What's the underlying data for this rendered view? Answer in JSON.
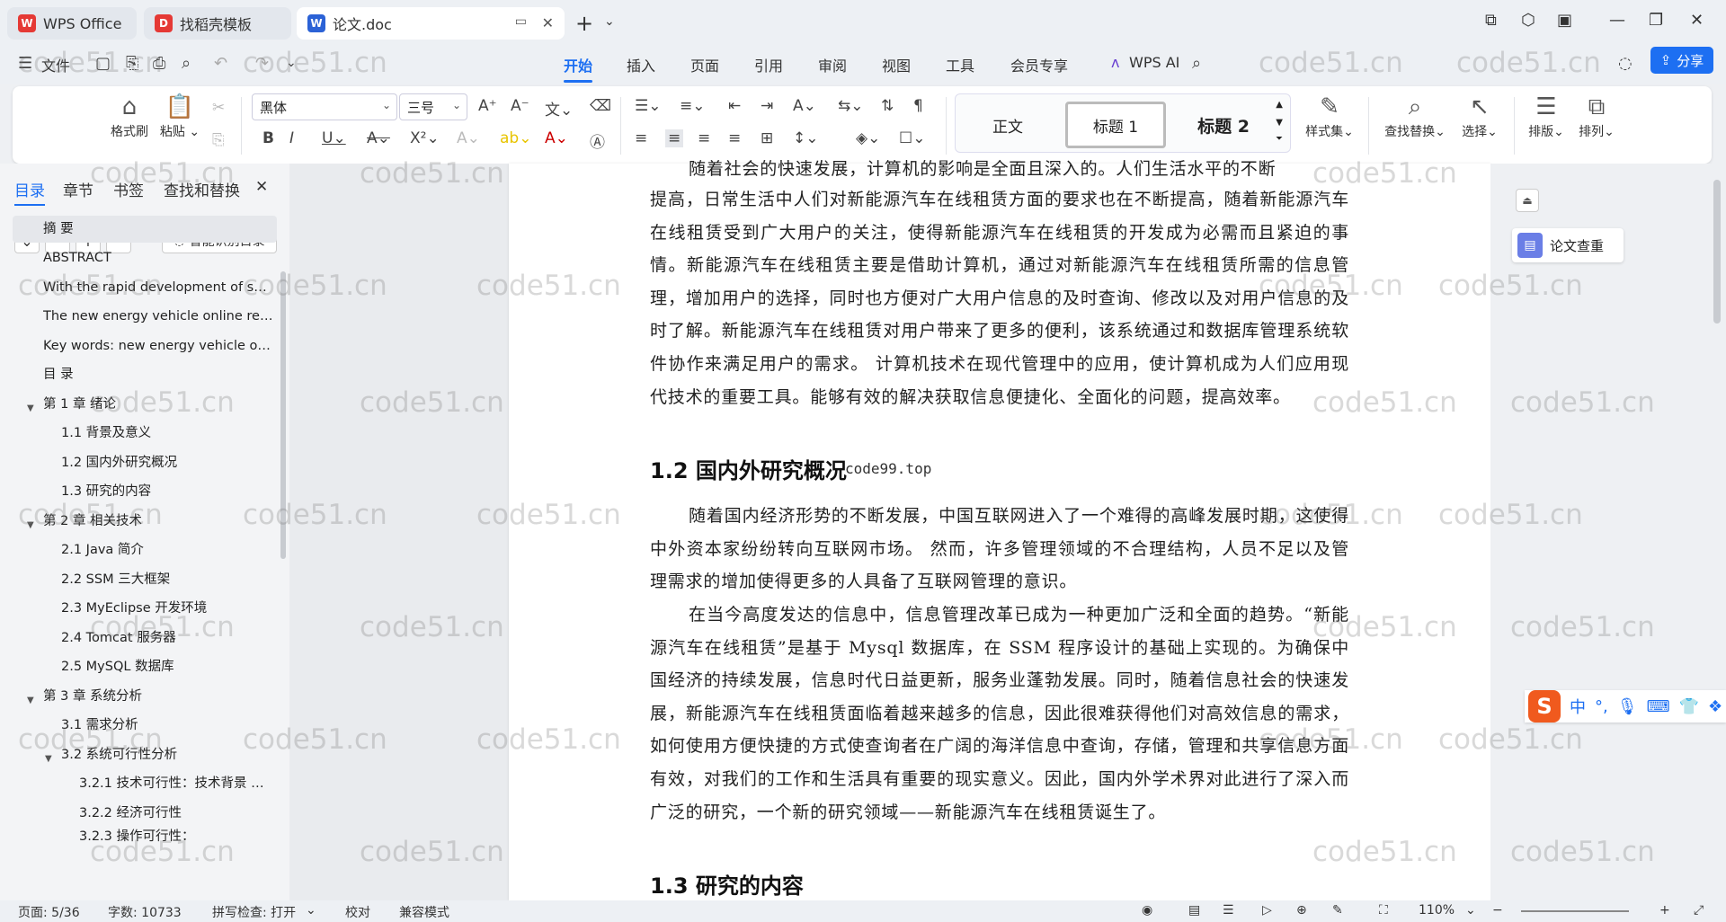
{
  "tabs": [
    {
      "label": "WPS Office",
      "logo": "W"
    },
    {
      "label": "找稻壳模板",
      "logo": "D"
    },
    {
      "label": "论文.doc",
      "logo": "W"
    }
  ],
  "menu": {
    "file": "文件",
    "items": [
      "开始",
      "插入",
      "页面",
      "引用",
      "审阅",
      "视图",
      "工具",
      "会员专享"
    ],
    "active": "开始",
    "wps_ai": "WPS AI",
    "share": "分享"
  },
  "ribbon": {
    "format_painter": "格式刷",
    "paste": "粘贴",
    "font": "黑体",
    "size": "三号",
    "styles": [
      "正文",
      "标题 1",
      "标题 2"
    ],
    "style_set": "样式集",
    "find_replace": "查找替换",
    "select": "选择",
    "layout": "排版",
    "arrange": "排列"
  },
  "sidebar": {
    "tabs": [
      "目录",
      "章节",
      "书签",
      "查找和替换"
    ],
    "ai_toc": "智能识别目录",
    "toc": [
      "摘  要",
      "ABSTRACT",
      "With the rapid development of s…",
      "The new energy vehicle online re…",
      "Key words: new energy vehicle o…",
      "目  录",
      "第 1 章  绪论",
      "1.1 背景及意义",
      "1.2 国内外研究概况",
      "1.3 研究的内容",
      "第 2 章  相关技术",
      "2.1 Java 简介",
      "2.2 SSM 三大框架",
      "2.3 MyEclipse 开发环境",
      "2.4 Tomcat 服务器",
      "2.5 MySQL 数据库",
      "第 3 章  系统分析",
      "3.1 需求分析",
      "3.2 系统可行性分析",
      "3.2.1 技术可行性：技术背景  …",
      "3.2.2 经济可行性",
      "3.2.3 操作可行性："
    ]
  },
  "document": {
    "p0_top": "随着社会的快速发展，计算机的影响是全面且深入的。人们生活水平的不断",
    "p0": "提高，日常生活中人们对新能源汽车在线租赁方面的要求也在不断提高，随着新能源汽车在线租赁受到广大用户的关注，使得新能源汽车在线租赁的开发成为必需而且紧迫的事情。新能源汽车在线租赁主要是借助计算机，通过对新能源汽车在线租赁所需的信息管理，增加用户的选择，同时也方便对广大用户信息的及时查询、修改以及对用户信息的及时了解。新能源汽车在线租赁对用户带来了更多的便利，该系统通过和数据库管理系统软件协作来满足用户的需求。 计算机技术在现代管理中的应用，使计算机成为人们应用现代技术的重要工具。能够有效的解决获取信息便捷化、全面化的问题，提高效率。",
    "h12": "1.2  国内外研究概况",
    "overlay": "code99.top",
    "p1": "随着国内经济形势的不断发展，中国互联网进入了一个难得的高峰发展时期，这使得中外资本家纷纷转向互联网市场。 然而，许多管理领域的不合理结构，人员不足以及管理需求的增加使得更多的人具备了互联网管理的意识。",
    "p2": "在当今高度发达的信息中，信息管理改革已成为一种更加广泛和全面的趋势。“新能源汽车在线租赁”是基于 Mysql 数据库，在 SSM 程序设计的基础上实现的。为确保中国经济的持续发展，信息时代日益更新，服务业蓬勃发展。同时，随着信息社会的快速发展，新能源汽车在线租赁面临着越来越多的信息，因此很难获得他们对高效信息的需求，如何使用方便快捷的方式使查询者在广阔的海洋信息中查询，存储，管理和共享信息方面有效，对我们的工作和生活具有重要的现实意义。因此，国内外学术界对此进行了深入而广泛的研究，一个新的研究领域——新能源汽车在线租赁诞生了。",
    "h13": "1.3  研究的内容"
  },
  "right_panel": {
    "paper_check": "论文查重"
  },
  "ime": {
    "lang": "中"
  },
  "status": {
    "page": "页面: 5/36",
    "words": "字数: 10733",
    "spell": "拼写检查: 打开",
    "proof": "校对",
    "compat": "兼容模式",
    "zoom": "110%"
  },
  "watermark": "code51.cn",
  "colors": {
    "accent": "#1d6ff2",
    "wps_red": "#e53935"
  }
}
